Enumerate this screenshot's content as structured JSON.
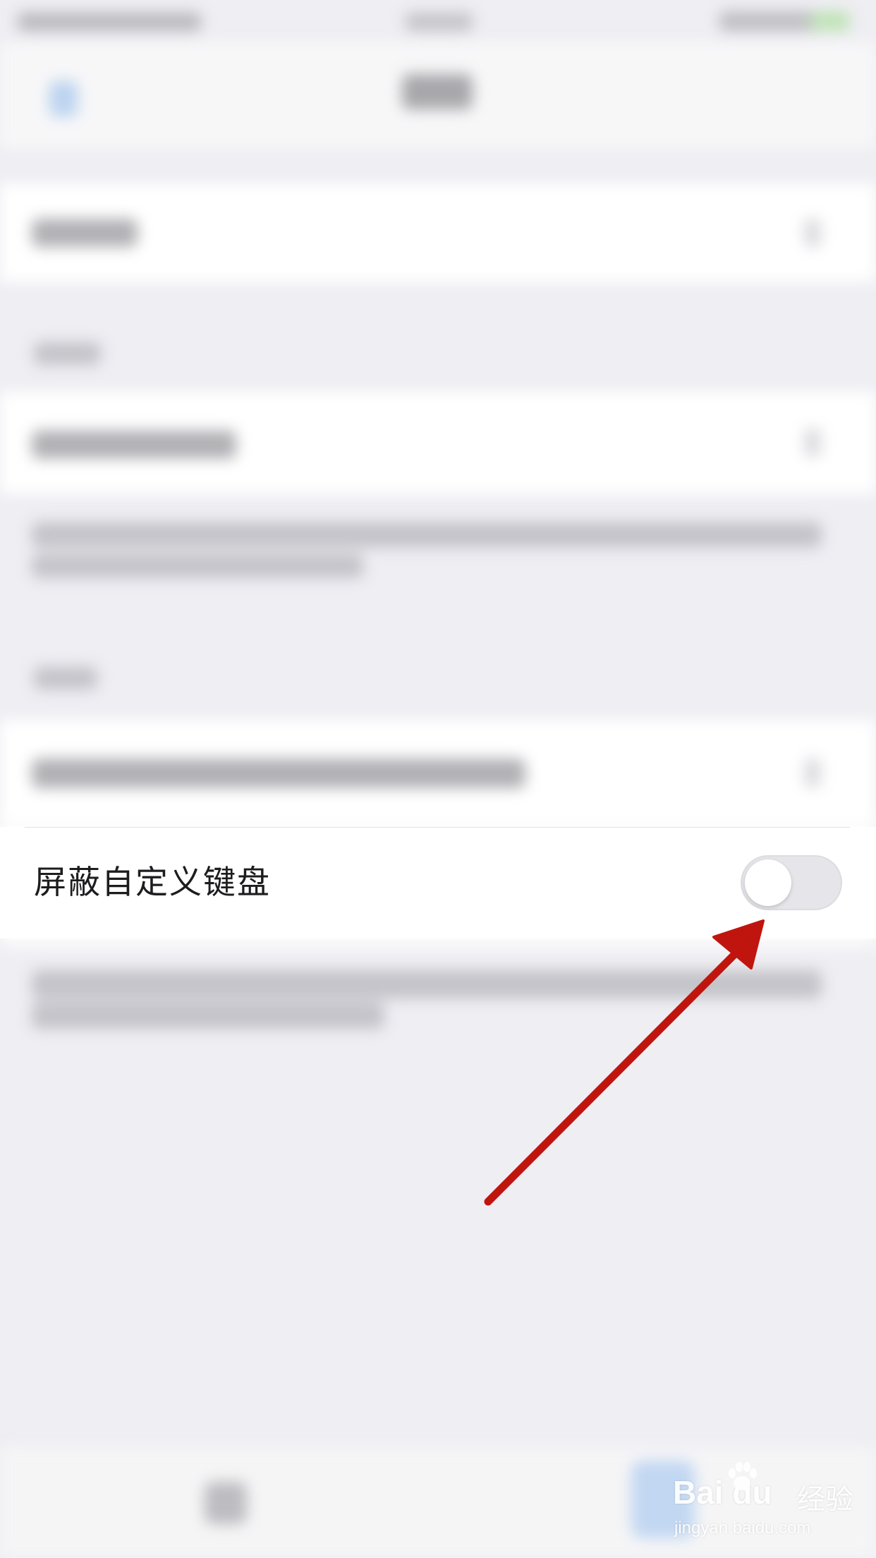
{
  "highlighted_row": {
    "label": "屏蔽自定义键盘",
    "toggle_on": false
  },
  "annotation": {
    "arrow_color": "#c0150e",
    "icon": "red-arrow-icon"
  },
  "watermark": {
    "logo_text": "Bai du",
    "product": "经验",
    "url": "jingyan.baidu.com"
  },
  "colors": {
    "page_background": "#efeef3",
    "cell_background": "#ffffff",
    "toggle_off": "#e6e6ea"
  }
}
